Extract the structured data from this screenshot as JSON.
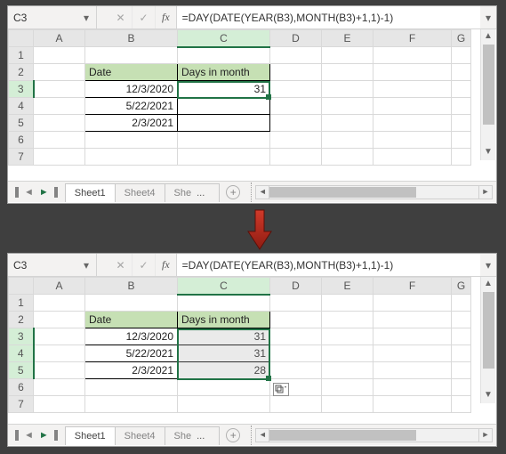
{
  "formula_bar": {
    "cell_ref": "C3",
    "cancel_glyph": "✕",
    "enter_glyph": "✓",
    "fx_label": "fx",
    "formula": "=DAY(DATE(YEAR(B3),MONTH(B3)+1,1)-1)"
  },
  "columns": [
    "A",
    "B",
    "C",
    "D",
    "E",
    "F",
    "G"
  ],
  "top": {
    "rows": [
      "1",
      "2",
      "3",
      "4",
      "5",
      "6",
      "7"
    ],
    "header": {
      "date": "Date",
      "days": "Days in month"
    },
    "data": [
      {
        "date": "12/3/2020",
        "days": "31"
      },
      {
        "date": "5/22/2021",
        "days": ""
      },
      {
        "date": "2/3/2021",
        "days": ""
      }
    ]
  },
  "bottom": {
    "rows": [
      "1",
      "2",
      "3",
      "4",
      "5",
      "6",
      "7"
    ],
    "header": {
      "date": "Date",
      "days": "Days in month"
    },
    "data": [
      {
        "date": "12/3/2020",
        "days": "31"
      },
      {
        "date": "5/22/2021",
        "days": "31"
      },
      {
        "date": "2/3/2021",
        "days": "28"
      }
    ]
  },
  "tabs": {
    "t1": "Sheet1",
    "t2": "Sheet4",
    "t3": "She",
    "dots": "...",
    "plus": "+"
  },
  "nav": {
    "first": "◄",
    "prev": "◄",
    "next": "►",
    "last": "►"
  },
  "chart_data": {
    "type": "table",
    "title": "Days in month from date (Excel formula demo)",
    "before": [
      [
        "Date",
        "Days in month"
      ],
      [
        "12/3/2020",
        31
      ],
      [
        "5/22/2021",
        null
      ],
      [
        "2/3/2021",
        null
      ]
    ],
    "after": [
      [
        "Date",
        "Days in month"
      ],
      [
        "12/3/2020",
        31
      ],
      [
        "5/22/2021",
        31
      ],
      [
        "2/3/2021",
        28
      ]
    ],
    "formula": "=DAY(DATE(YEAR(B3),MONTH(B3)+1,1)-1)"
  }
}
